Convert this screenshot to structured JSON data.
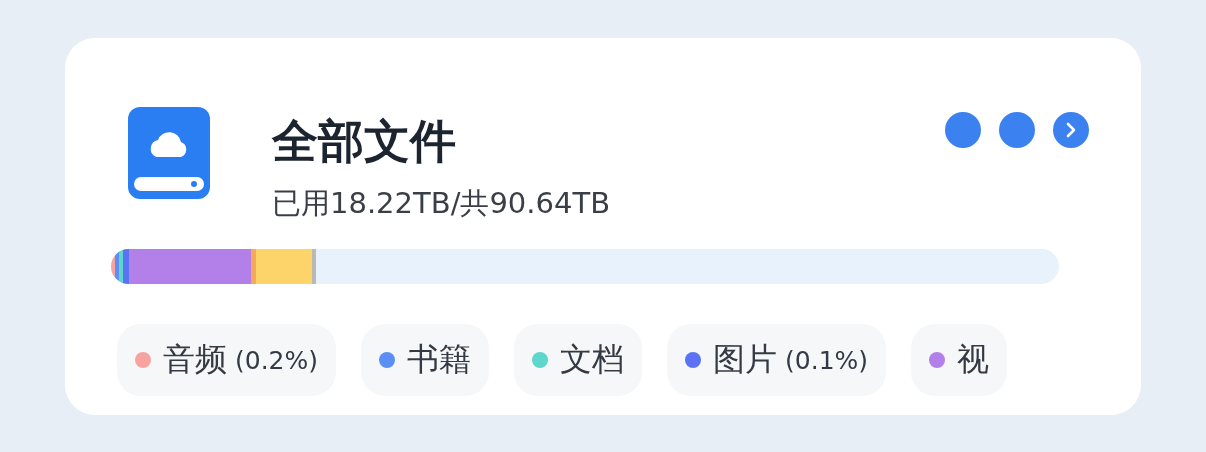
{
  "title": "全部文件",
  "usage": "已用18.22TB/共90.64TB",
  "segments": [
    {
      "color": "#f7a4a0"
    },
    {
      "color": "#5b8ff3"
    },
    {
      "color": "#5fd6cc"
    },
    {
      "color": "#5b72f5"
    },
    {
      "color": "#b37fe8"
    },
    {
      "color": "#f7a85a"
    },
    {
      "color": "#fdd46a"
    },
    {
      "color": "#b8b8b8"
    }
  ],
  "categories": [
    {
      "label": "音频",
      "share": "(0.2%)",
      "color": "#f7a4a0"
    },
    {
      "label": "书籍",
      "color": "#5b8ff3"
    },
    {
      "label": "文档",
      "color": "#5fd6cc"
    },
    {
      "label": "图片",
      "share": "(0.1%)",
      "color": "#5b72f5"
    },
    {
      "label": "视",
      "color": "#b37fe8"
    }
  ]
}
